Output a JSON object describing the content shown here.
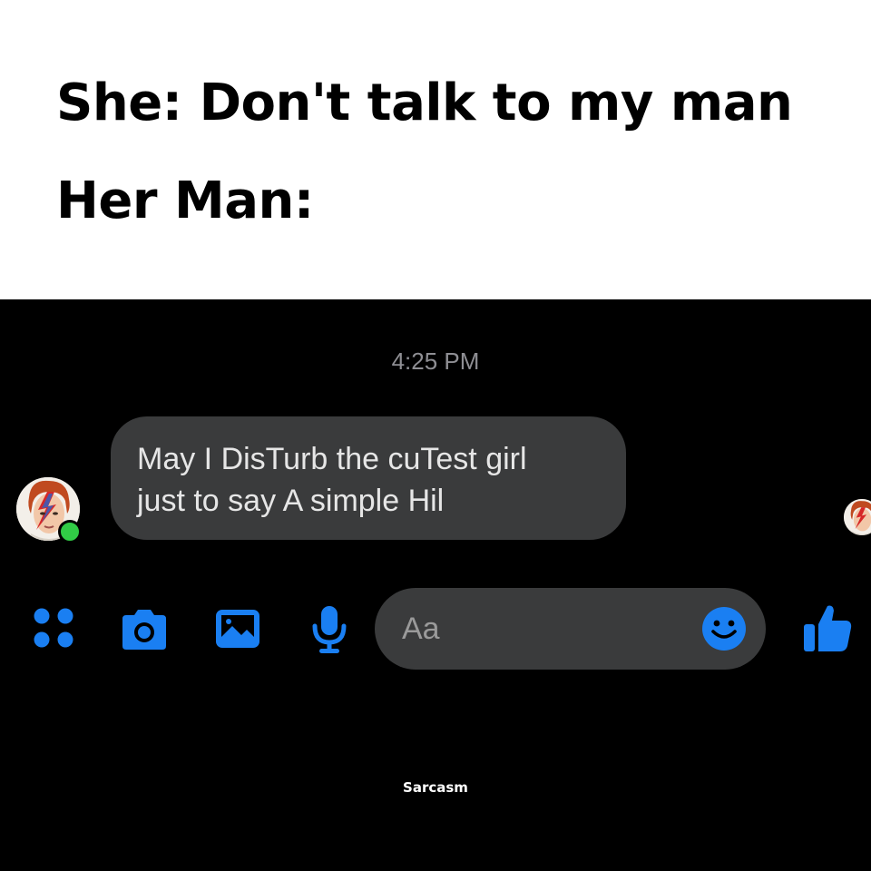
{
  "caption": {
    "line1": "She: Don't talk to my man",
    "line2": "Her Man:"
  },
  "chat": {
    "timestamp": "4:25 PM",
    "message": {
      "line1": "May I DisTurb the cuTest girl",
      "line2": "just to say A simple Hil"
    },
    "sender_online": true
  },
  "composer": {
    "placeholder": "Aa",
    "icons": [
      "more-icon",
      "camera-icon",
      "gallery-icon",
      "microphone-icon",
      "emoji-icon",
      "thumbs-up-icon"
    ]
  },
  "watermark": "Sarcasm",
  "colors": {
    "accent": "#1a7ff2",
    "bubble": "#3a3b3c",
    "online": "#31cc46"
  }
}
